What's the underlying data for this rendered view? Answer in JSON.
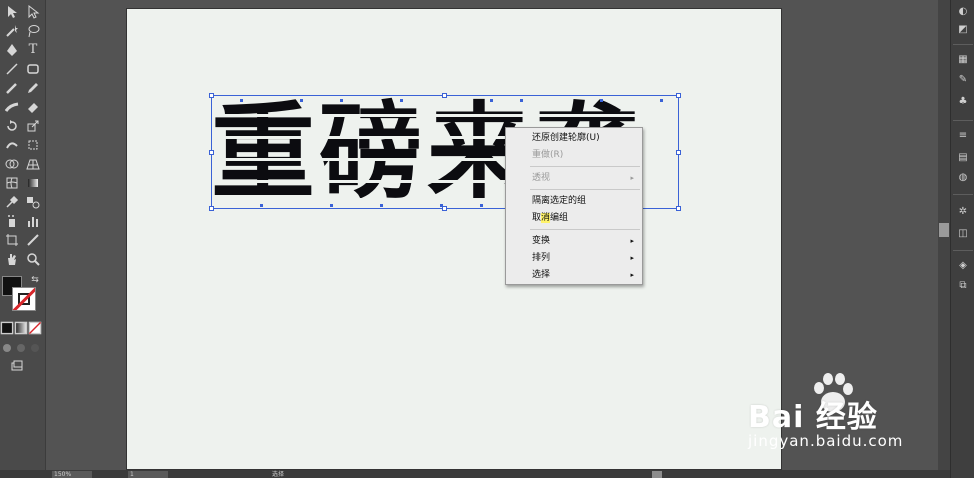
{
  "app": {
    "name": "Adobe Illustrator"
  },
  "tools": [
    "selection-tool",
    "direct-selection-tool",
    "magic-wand-tool",
    "lasso-tool",
    "pen-tool",
    "type-tool",
    "line-tool",
    "rectangle-tool",
    "paintbrush-tool",
    "pencil-tool",
    "blob-brush-tool",
    "eraser-tool",
    "rotate-tool",
    "scale-tool",
    "warp-tool",
    "free-transform-tool",
    "shape-builder-tool",
    "perspective-grid-tool",
    "mesh-tool",
    "gradient-tool",
    "eyedropper-tool",
    "blend-tool",
    "symbol-sprayer-tool",
    "column-graph-tool",
    "artboard-tool",
    "slice-tool",
    "hand-tool",
    "zoom-tool"
  ],
  "tool_glyphs": {
    "type": "T"
  },
  "colors": {
    "fill": "#111111",
    "stroke": "#ffffff",
    "selection": "#3a62d6",
    "artboard": "#eef2ee",
    "highlight": "#fff36a"
  },
  "artwork": {
    "text": "重磅来袭"
  },
  "context_menu": {
    "items": [
      {
        "label": "还原创建轮廓(U)",
        "enabled": true,
        "submenu": false
      },
      {
        "label": "重做(R)",
        "enabled": false,
        "submenu": false
      },
      {
        "label": "透视",
        "enabled": false,
        "submenu": true
      },
      {
        "label": "隔离选定的组",
        "enabled": true,
        "submenu": false
      },
      {
        "label_before": "取",
        "label_highlight": "消",
        "label_after": "编组",
        "enabled": true,
        "submenu": false
      },
      {
        "label": "变换",
        "enabled": true,
        "submenu": true
      },
      {
        "label": "排列",
        "enabled": true,
        "submenu": true
      },
      {
        "label": "选择",
        "enabled": true,
        "submenu": true
      }
    ],
    "arrow": "▸"
  },
  "status_bar": {
    "zoom": "150%",
    "page": "1",
    "tool_label": "选择"
  },
  "watermark": {
    "brand": "Bai  经验",
    "url": "jingyan.baidu.com"
  }
}
